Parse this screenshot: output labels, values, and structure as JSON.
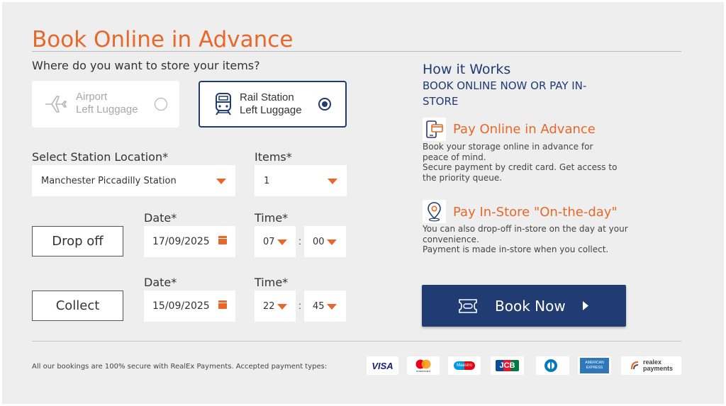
{
  "header": {
    "title": "Book Online in Advance",
    "question": "Where do you want to store your items?"
  },
  "storage_options": [
    {
      "label_line1": "Airport",
      "label_line2": "Left Luggage",
      "icon": "airplane-icon",
      "selected": false
    },
    {
      "label_line1": "Rail Station",
      "label_line2": "Left Luggage",
      "icon": "train-icon",
      "selected": true
    }
  ],
  "form": {
    "station_label": "Select Station Location*",
    "station_value": "Manchester Piccadilly Station",
    "items_label": "Items*",
    "items_value": "1",
    "date_label": "Date*",
    "time_label": "Time*",
    "dropoff": {
      "button": "Drop off",
      "date": "17/09/2025",
      "hour": "07",
      "minute": "00"
    },
    "collect": {
      "button": "Collect",
      "date": "15/09/2025",
      "hour": "22",
      "minute": "45"
    },
    "colon": ":"
  },
  "how_it_works": {
    "title": "How it Works",
    "subtitle": "BOOK ONLINE NOW OR PAY IN-STORE",
    "features": [
      {
        "icon": "mobile-card-icon",
        "title": "Pay Online in Advance",
        "line1": "Book your storage online in advance for peace of mind.",
        "line2": "Secure payment by credit card. Get access to the priority queue."
      },
      {
        "icon": "location-pin-icon",
        "title": "Pay In-Store \"On-the-day\"",
        "line1": "You can also drop-off in-store on the day at your convenience.",
        "line2": "Payment is made in-store when you collect."
      }
    ]
  },
  "book_button": {
    "label": "Book Now",
    "icon": "ticket-icon"
  },
  "footer": {
    "secure_text": "All our bookings are 100% secure with RealEx Payments. Accepted payment types:",
    "cards": [
      "VISA",
      "mastercard",
      "Maestro",
      "JCB",
      "Diners Club",
      "AMERICAN EXPRESS",
      "realex payments"
    ]
  },
  "colors": {
    "accent": "#e8672a",
    "navy": "#213b73",
    "panel": "#eeeeee"
  }
}
